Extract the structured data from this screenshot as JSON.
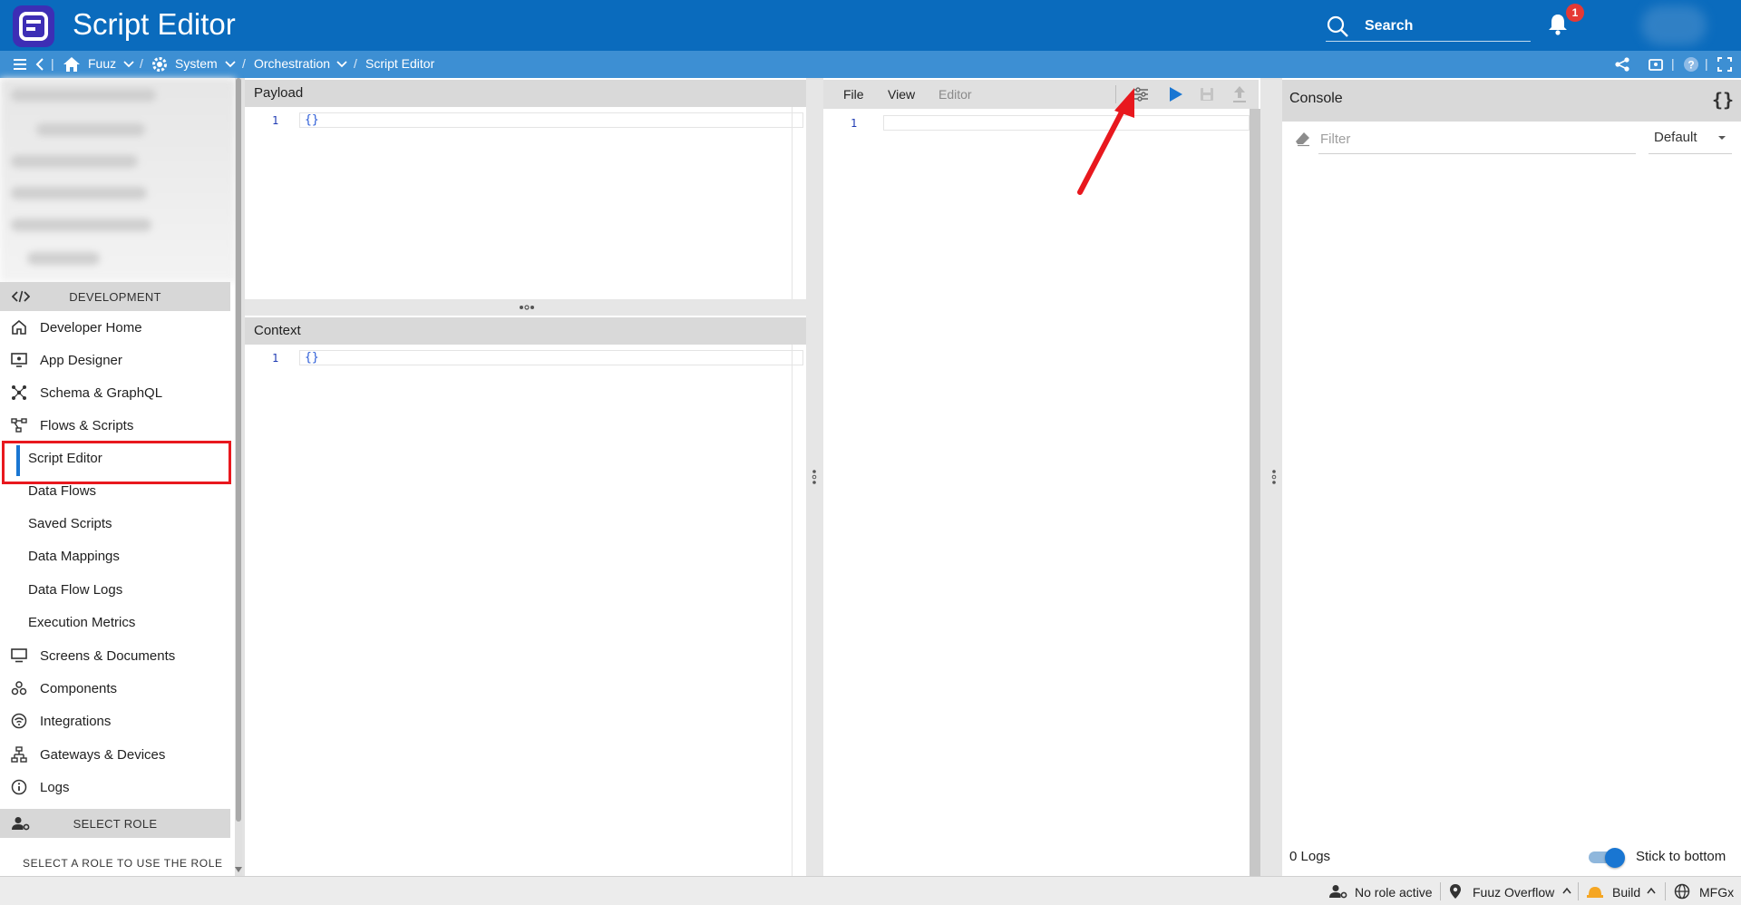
{
  "app": {
    "title": "Script Editor"
  },
  "header": {
    "search_label": "Search",
    "notification_count": "1"
  },
  "breadcrumb": {
    "items": [
      "Fuuz",
      "System",
      "Orchestration",
      "Script Editor"
    ]
  },
  "sidebar": {
    "development_header": "DEVELOPMENT",
    "items": [
      {
        "label": "Developer Home"
      },
      {
        "label": "App Designer"
      },
      {
        "label": "Schema & GraphQL"
      },
      {
        "label": "Flows & Scripts"
      },
      {
        "label": "Script Editor",
        "active": true
      },
      {
        "label": "Data Flows"
      },
      {
        "label": "Saved Scripts"
      },
      {
        "label": "Data Mappings"
      },
      {
        "label": "Data Flow Logs"
      },
      {
        "label": "Execution Metrics"
      },
      {
        "label": "Screens & Documents"
      },
      {
        "label": "Components"
      },
      {
        "label": "Integrations"
      },
      {
        "label": "Gateways & Devices"
      },
      {
        "label": "Logs"
      }
    ],
    "role_header": "SELECT ROLE",
    "role_hint": "SELECT A ROLE TO USE THE ROLE"
  },
  "payload": {
    "title": "Payload",
    "line_number": "1",
    "code": "{}"
  },
  "context": {
    "title": "Context",
    "line_number": "1",
    "code": "{}"
  },
  "editor": {
    "menu": [
      "File",
      "View",
      "Editor"
    ],
    "line_number": "1"
  },
  "console": {
    "title": "Console",
    "filter_placeholder": "Filter",
    "level": "Default",
    "logs_count": "0 Logs",
    "stick_label": "Stick to bottom",
    "stick_enabled": true
  },
  "statusbar": {
    "role": "No role active",
    "location": "Fuuz Overflow",
    "mode": "Build",
    "tenant": "MFGx"
  },
  "colors": {
    "header": "#0a6bbd",
    "breadcrumb": "#3d8fd3",
    "accent": "#1976d2",
    "highlight": "#e8181e",
    "logo": "#3d2eb5"
  },
  "icons": [
    "menu-icon",
    "back-icon",
    "home-icon",
    "gear-icon",
    "search-icon",
    "bell-icon",
    "settings-sliders-icon",
    "play-icon",
    "save-icon",
    "upload-icon",
    "eraser-icon",
    "braces-icon",
    "share-icon",
    "help-icon",
    "fullscreen-icon"
  ]
}
